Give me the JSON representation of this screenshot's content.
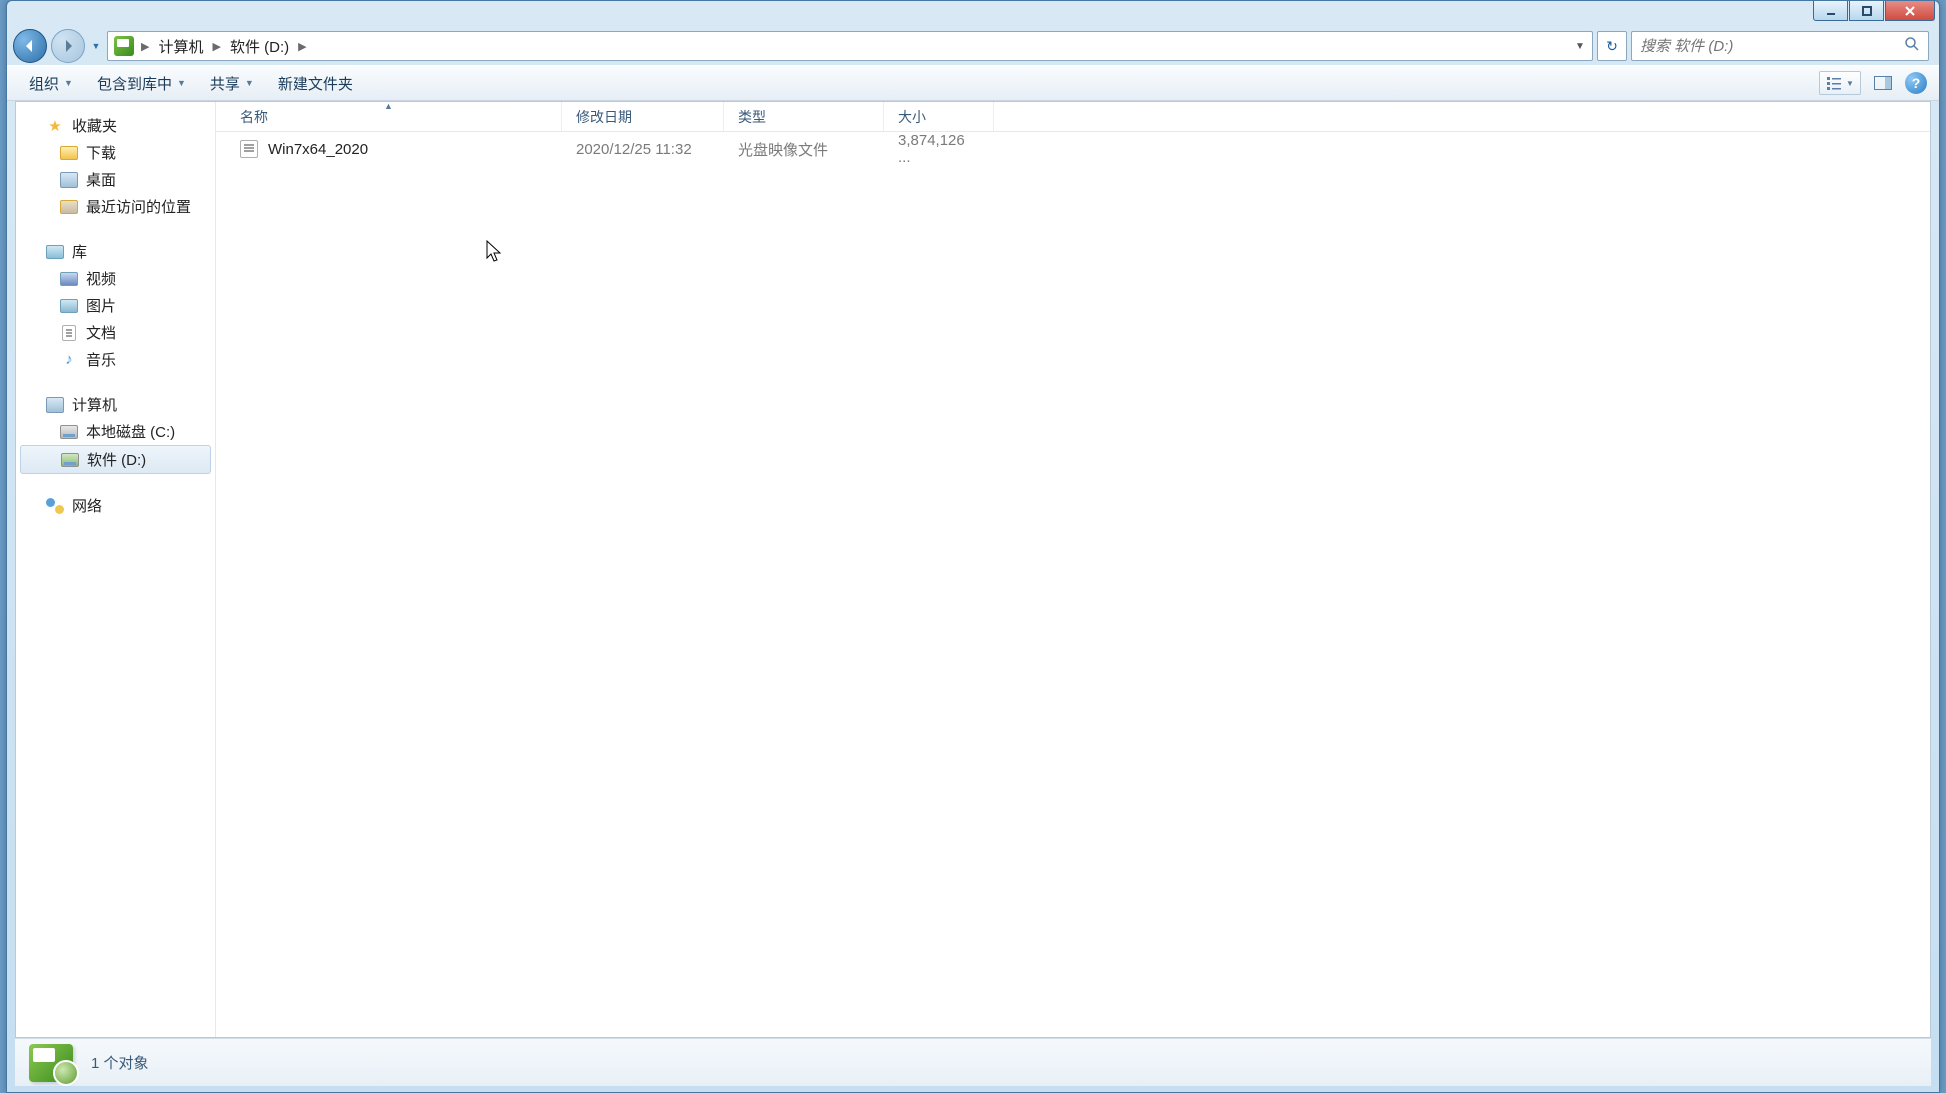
{
  "breadcrumb": {
    "computer": "计算机",
    "drive": "软件 (D:)"
  },
  "search": {
    "placeholder": "搜索 软件 (D:)"
  },
  "toolbar": {
    "organize": "组织",
    "include": "包含到库中",
    "share": "共享",
    "newfolder": "新建文件夹"
  },
  "columns": {
    "name": "名称",
    "date": "修改日期",
    "type": "类型",
    "size": "大小"
  },
  "nav": {
    "favorites": "收藏夹",
    "downloads": "下载",
    "desktop": "桌面",
    "recent": "最近访问的位置",
    "libraries": "库",
    "videos": "视频",
    "pictures": "图片",
    "documents": "文档",
    "music": "音乐",
    "computer": "计算机",
    "localC": "本地磁盘 (C:)",
    "driveD": "软件 (D:)",
    "network": "网络"
  },
  "files": [
    {
      "name": "Win7x64_2020",
      "date": "2020/12/25 11:32",
      "type": "光盘映像文件",
      "size": "3,874,126 ..."
    }
  ],
  "status": {
    "count": "1 个对象"
  }
}
